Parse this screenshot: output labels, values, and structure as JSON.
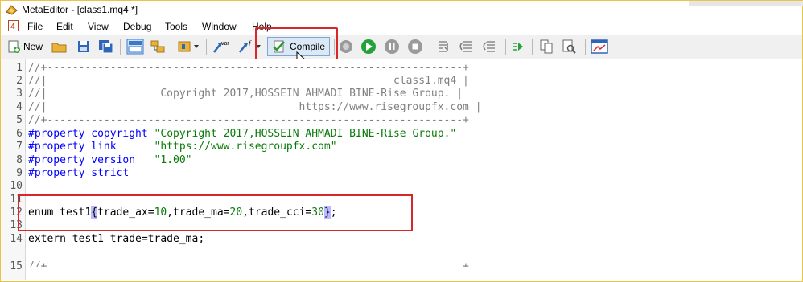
{
  "window": {
    "title": "MetaEditor - [class1.mq4 *]"
  },
  "menu": [
    "File",
    "Edit",
    "View",
    "Debug",
    "Tools",
    "Window",
    "Help"
  ],
  "toolbar": {
    "new_label": "New",
    "compile_label": "Compile",
    "var_label": "var",
    "f_label": "f"
  },
  "editor": {
    "line_numbers": [
      "1",
      "2",
      "3",
      "4",
      "5",
      "6",
      "7",
      "8",
      "9",
      "10",
      "11",
      "12",
      "13",
      "14",
      "15"
    ],
    "lines": {
      "l1": "//+------------------------------------------------------------------+",
      "l2": "//|                                                       class1.mq4 |",
      "l3": "//|                  Copyright 2017,HOSSEIN AHMADI BINE-Rise Group. |",
      "l4": "//|                                        https://www.risegroupfx.com |",
      "l5": "//+------------------------------------------------------------------+",
      "l6_kw": "#property copyright ",
      "l6_str": "\"Copyright 2017,HOSSEIN AHMADI BINE-Rise Group.\"",
      "l7_kw": "#property link      ",
      "l7_str": "\"https://www.risegroupfx.com\"",
      "l8_kw": "#property version   ",
      "l8_str": "\"1.00\"",
      "l9_kw": "#property strict",
      "l12_a": "enum test1",
      "l12_b": "{",
      "l12_c": "trade_ax=",
      "l12_d": "10",
      "l12_e": ",trade_ma=",
      "l12_f": "20",
      "l12_g": ",trade_cci=",
      "l12_h": "30",
      "l12_i": "}",
      "l12_j": ";",
      "l14": "extern test1 trade=trade_ma;",
      "l15": "//+                                                                  +"
    }
  }
}
